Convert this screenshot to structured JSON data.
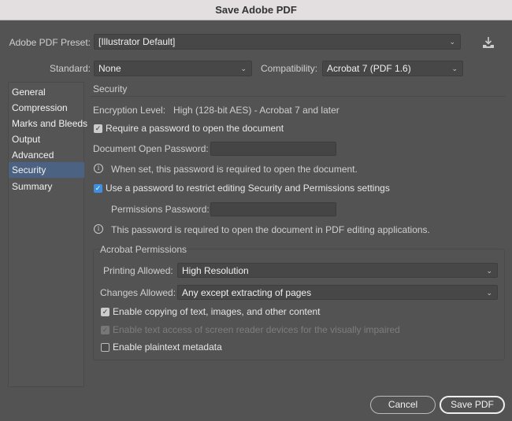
{
  "window": {
    "title": "Save Adobe PDF"
  },
  "preset": {
    "label": "Adobe PDF Preset:",
    "value": "[Illustrator Default]"
  },
  "standard": {
    "label": "Standard:",
    "value": "None"
  },
  "compatibility": {
    "label": "Compatibility:",
    "value": "Acrobat 7 (PDF 1.6)"
  },
  "sidebar": {
    "items": [
      {
        "label": "General"
      },
      {
        "label": "Compression"
      },
      {
        "label": "Marks and Bleeds"
      },
      {
        "label": "Output"
      },
      {
        "label": "Advanced"
      },
      {
        "label": "Security"
      },
      {
        "label": "Summary"
      }
    ],
    "selected": "Security"
  },
  "security": {
    "heading": "Security",
    "encryption_label": "Encryption Level:",
    "encryption_value": "High (128-bit AES) - Acrobat 7 and later",
    "require_password_label": "Require a password to open the document",
    "open_password_label": "Document Open Password:",
    "open_password_info": "When set, this password is required to open the document.",
    "restrict_label": "Use a password to restrict editing Security and Permissions settings",
    "permissions_password_label": "Permissions Password:",
    "permissions_info": "This password is required to open the document in PDF editing applications."
  },
  "permissions": {
    "title": "Acrobat Permissions",
    "printing_label": "Printing Allowed:",
    "printing_value": "High Resolution",
    "changes_label": "Changes Allowed:",
    "changes_value": "Any except extracting of pages",
    "copying_label": "Enable copying of text, images, and other content",
    "screen_reader_label": "Enable text access of screen reader devices for the visually impaired",
    "plaintext_label": "Enable plaintext metadata"
  },
  "buttons": {
    "cancel": "Cancel",
    "save": "Save PDF"
  }
}
